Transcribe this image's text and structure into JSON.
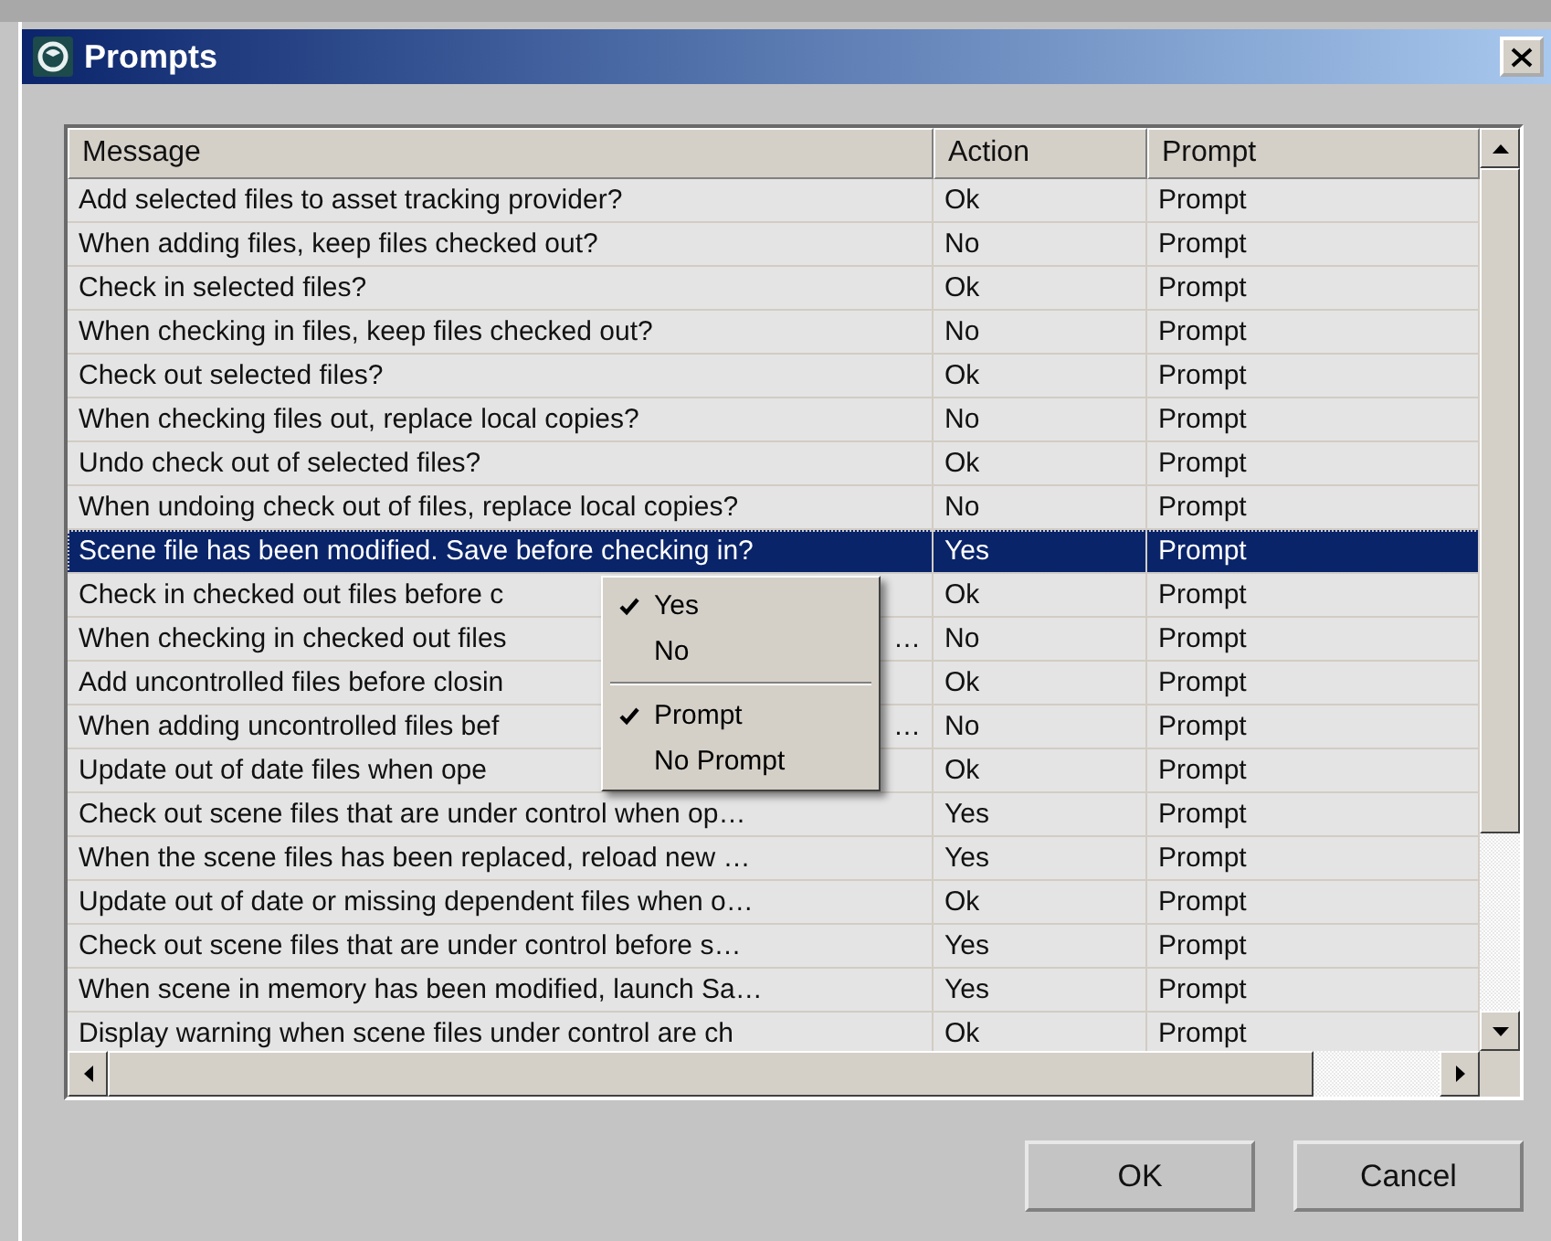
{
  "window": {
    "title": "Prompts"
  },
  "table": {
    "columns": [
      "Message",
      "Action",
      "Prompt"
    ],
    "rows": [
      {
        "message": "Add selected files to asset tracking provider?",
        "action": "Ok",
        "prompt": "Prompt",
        "selected": false
      },
      {
        "message": "When adding files, keep files checked out?",
        "action": "No",
        "prompt": "Prompt",
        "selected": false
      },
      {
        "message": "Check in selected files?",
        "action": "Ok",
        "prompt": "Prompt",
        "selected": false
      },
      {
        "message": "When checking in files, keep files checked out?",
        "action": "No",
        "prompt": "Prompt",
        "selected": false
      },
      {
        "message": "Check out selected files?",
        "action": "Ok",
        "prompt": "Prompt",
        "selected": false
      },
      {
        "message": "When checking files out, replace local copies?",
        "action": "No",
        "prompt": "Prompt",
        "selected": false
      },
      {
        "message": "Undo check out of selected files?",
        "action": "Ok",
        "prompt": "Prompt",
        "selected": false
      },
      {
        "message": "When undoing check out of files, replace local copies?",
        "action": "No",
        "prompt": "Prompt",
        "selected": false
      },
      {
        "message": "Scene file has been modified.  Save before checking in?",
        "action": "Yes",
        "prompt": "Prompt",
        "selected": true
      },
      {
        "message": "Check in checked out files before c",
        "action": "Ok",
        "prompt": "Prompt",
        "selected": false
      },
      {
        "message": "When checking in checked out files",
        "tail": "…",
        "action": "No",
        "prompt": "Prompt",
        "selected": false
      },
      {
        "message": "Add uncontrolled files before closin",
        "action": "Ok",
        "prompt": "Prompt",
        "selected": false
      },
      {
        "message": "When adding uncontrolled files bef",
        "tail": "…",
        "action": "No",
        "prompt": "Prompt",
        "selected": false
      },
      {
        "message": "Update out of date files when ope",
        "action": "Ok",
        "prompt": "Prompt",
        "selected": false
      },
      {
        "message": "Check out scene files that are under control when op…",
        "action": "Yes",
        "prompt": "Prompt",
        "selected": false
      },
      {
        "message": "When the scene files has been replaced, reload new …",
        "action": "Yes",
        "prompt": "Prompt",
        "selected": false
      },
      {
        "message": "Update out of date or missing dependent files when o…",
        "action": "Ok",
        "prompt": "Prompt",
        "selected": false
      },
      {
        "message": "Check out scene files that are under control before s…",
        "action": "Yes",
        "prompt": "Prompt",
        "selected": false
      },
      {
        "message": "When scene in memory has been modified, launch Sa…",
        "action": "Yes",
        "prompt": "Prompt",
        "selected": false
      },
      {
        "message": "Display warning when scene files under control are ch",
        "action": "Ok",
        "prompt": "Prompt",
        "selected": false
      }
    ]
  },
  "context_menu": {
    "items": [
      {
        "kind": "item",
        "label": "Yes",
        "checked": true
      },
      {
        "kind": "item",
        "label": "No",
        "checked": false
      },
      {
        "kind": "separator"
      },
      {
        "kind": "item",
        "label": "Prompt",
        "checked": true
      },
      {
        "kind": "item",
        "label": "No Prompt",
        "checked": false
      }
    ]
  },
  "buttons": [
    "OK",
    "Cancel"
  ]
}
